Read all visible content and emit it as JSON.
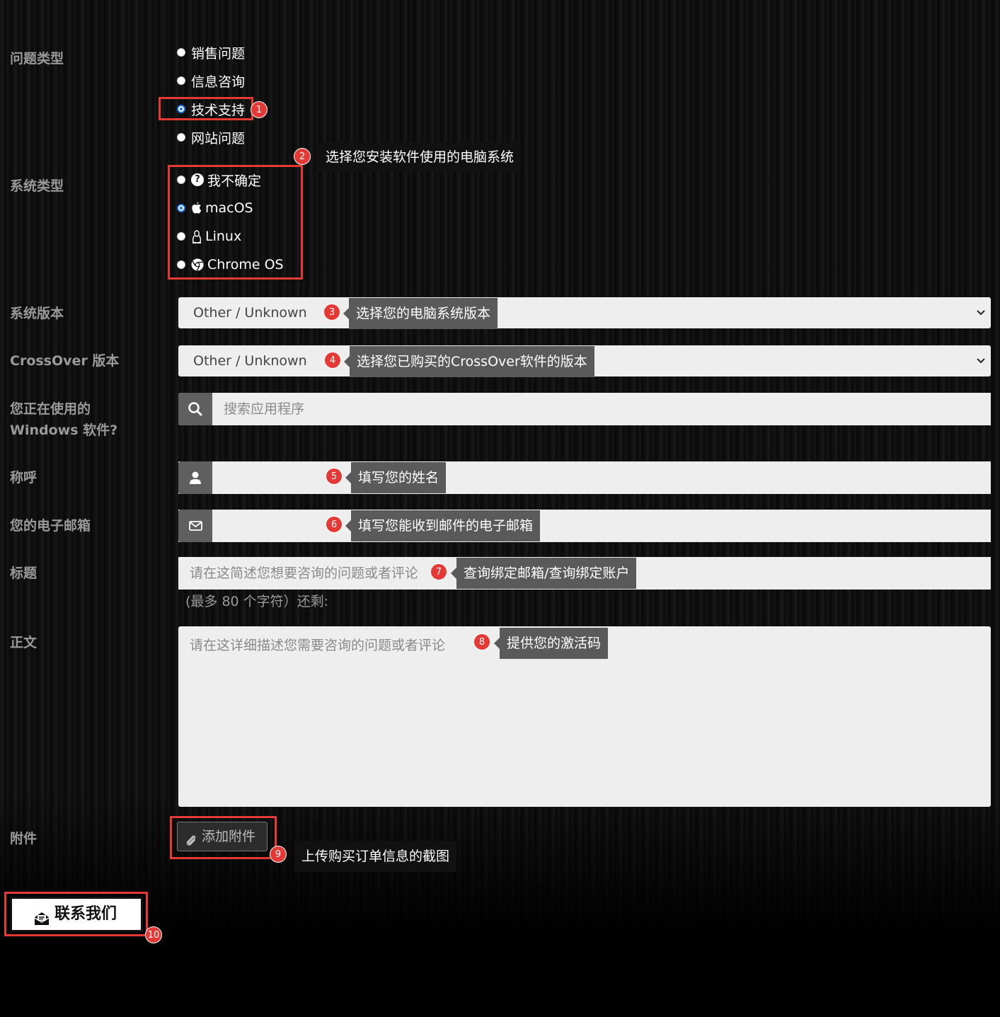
{
  "labels": {
    "issue_type": "问题类型",
    "system_type": "系统类型",
    "system_version": "系统版本",
    "crossover_version": "CrossOver 版本",
    "windows_software_line1": "您正在使用的",
    "windows_software_line2": "Windows 软件?",
    "name": "称呼",
    "email": "您的电子邮箱",
    "title": "标题",
    "body": "正文",
    "attachment": "附件"
  },
  "issue_types": [
    {
      "label": "销售问题",
      "checked": false
    },
    {
      "label": "信息咨询",
      "checked": false
    },
    {
      "label": "技术支持",
      "checked": true
    },
    {
      "label": "网站问题",
      "checked": false
    }
  ],
  "system_types": [
    {
      "label": "我不确定",
      "icon": "question-circle-icon",
      "checked": false
    },
    {
      "label": "macOS",
      "icon": "apple-icon",
      "checked": true
    },
    {
      "label": "Linux",
      "icon": "linux-tux-icon",
      "checked": false
    },
    {
      "label": "Chrome OS",
      "icon": "chrome-icon",
      "checked": false
    }
  ],
  "system_version_select": {
    "value": "Other / Unknown"
  },
  "crossover_version_select": {
    "value": "Other / Unknown"
  },
  "software_search": {
    "placeholder": "搜索应用程序"
  },
  "title_field": {
    "placeholder": "请在这简述您想要咨询的问题或者评论",
    "char_hint": "(最多 80 个字符）还剩:"
  },
  "body_field": {
    "placeholder": "请在这详细描述您需要咨询的问题或者评论"
  },
  "attach_button": {
    "label": "添加附件"
  },
  "submit_button": {
    "label": "联系我们"
  },
  "annotations": {
    "badges": [
      "1",
      "2",
      "3",
      "4",
      "5",
      "6",
      "7",
      "8",
      "9",
      "10"
    ],
    "tip2": "选择您安装软件使用的电脑系统",
    "tip3": "选择您的电脑系统版本",
    "tip4": "选择您已购买的CrossOver软件的版本",
    "tip5": "填写您的姓名",
    "tip6": "填写您能收到邮件的电子邮箱",
    "tip7": "查询绑定邮箱/查询绑定账户",
    "tip8": "提供您的激活码",
    "tip9": "上传购买订单信息的截图"
  },
  "colors": {
    "annotation_red": "#e53935",
    "field_bg": "#eeeeee",
    "addon_bg": "#5f5f5f",
    "tooltip_bg": "#5a5a5a"
  }
}
